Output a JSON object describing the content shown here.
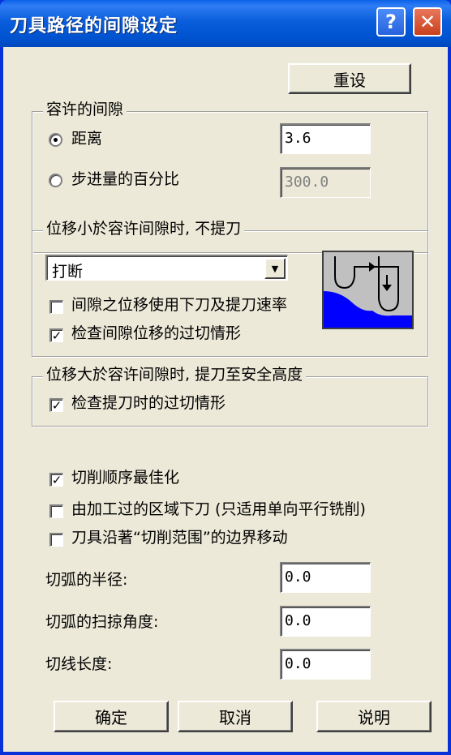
{
  "window": {
    "title": "刀具路径的间隙设定",
    "help_label": "?",
    "close_label": "✕"
  },
  "reset_label": "重设",
  "tolerance_group": {
    "legend": "容许的间隙",
    "distance_label": "距离",
    "distance_value": "3.6",
    "percent_label": "步进量的百分比",
    "percent_value": "300.0",
    "selected": "distance"
  },
  "small_move_group": {
    "legend": "位移小於容许间隙时, 不提刀",
    "combo_value": "打断",
    "feed_rate_label": "间隙之位移使用下刀及提刀速率",
    "feed_rate_checked": false,
    "gouge_label": "检查间隙位移的过切情形",
    "gouge_checked": true,
    "preview_colors": {
      "background": "#C0C0C0",
      "material": "#0000FF",
      "path": "#000000"
    }
  },
  "large_move_group": {
    "legend": "位移大於容许间隙时, 提刀至安全高度",
    "gouge_label": "检查提刀时的过切情形",
    "gouge_checked": true
  },
  "options": {
    "optimize_label": "切削顺序最佳化",
    "optimize_checked": true,
    "plunge_label": "由加工过的区域下刀 (只适用单向平行铣削)",
    "plunge_checked": false,
    "boundary_label": "刀具沿著“切削范围”的边界移动",
    "boundary_checked": false
  },
  "arc_radius": {
    "label": "切弧的半径:",
    "value": "0.0"
  },
  "arc_sweep": {
    "label": "切弧的扫掠角度:",
    "value": "0.0"
  },
  "line_length": {
    "label": "切线长度:",
    "value": "0.0"
  },
  "buttons": {
    "ok": "确定",
    "cancel": "取消",
    "help": "说明"
  },
  "colors": {
    "title_bar": "#0053D0",
    "face": "#ECE9D8",
    "close": "#C8401E"
  }
}
